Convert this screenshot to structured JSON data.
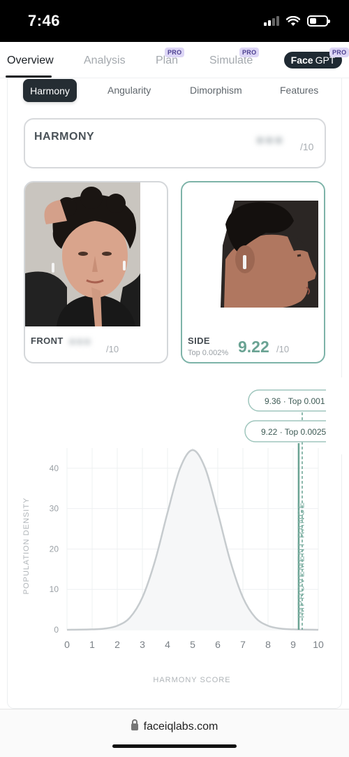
{
  "status_bar": {
    "time": "7:46",
    "icons": [
      "signal-icon",
      "wifi-icon",
      "battery-icon"
    ]
  },
  "nav": {
    "tabs": [
      {
        "label": "Overview",
        "active": true,
        "pro": false
      },
      {
        "label": "Analysis",
        "active": false,
        "pro": false
      },
      {
        "label": "Plan",
        "active": false,
        "pro": true
      },
      {
        "label": "Simulate",
        "active": false,
        "pro": true
      }
    ],
    "facegpt": {
      "bold": "Face",
      "rest": "GPT"
    },
    "pro_label": "PRO"
  },
  "sub_tabs": [
    {
      "label": "Harmony",
      "active": true
    },
    {
      "label": "Angularity",
      "active": false
    },
    {
      "label": "Dimorphism",
      "active": false
    },
    {
      "label": "Features",
      "active": false
    }
  ],
  "harmony": {
    "title": "HARMONY",
    "out_of": "/10"
  },
  "front": {
    "label": "FRONT",
    "out_of": "/10"
  },
  "side": {
    "label": "SIDE",
    "rank": "Top 0.002%",
    "score": "9.22",
    "out_of": "/10"
  },
  "chart_data": {
    "type": "area",
    "xlabel": "HARMONY SCORE",
    "ylabel": "POPULATION DENSITY",
    "x_ticks": [
      0,
      1,
      2,
      3,
      4,
      5,
      6,
      7,
      8,
      9,
      10
    ],
    "y_ticks": [
      0,
      10,
      20,
      30,
      40
    ],
    "xlim": [
      0,
      10
    ],
    "ylim": [
      0,
      45
    ],
    "curve": {
      "x": [
        0,
        1,
        1.5,
        2,
        2.5,
        3,
        3.5,
        4,
        4.5,
        5,
        5.5,
        6,
        6.5,
        7,
        7.5,
        8,
        8.5,
        9,
        10
      ],
      "y": [
        0,
        0.1,
        0.3,
        1,
        3,
        8,
        17,
        29,
        40,
        44.5,
        40,
        29,
        17,
        8,
        3,
        1,
        0.3,
        0.1,
        0
      ]
    },
    "markers": [
      {
        "value": 9.36,
        "label": "9.36 · Top 0.001",
        "style": "dashed"
      },
      {
        "value": 9.22,
        "label": "9.22 · Top 0.0025",
        "style": "solid"
      }
    ],
    "band_label": "IMPROVEMENT RANGE",
    "colors": {
      "curve": "#c6cbce",
      "marker": "#6aa393",
      "grid": "#eef0f2",
      "axis_text": "#7a8086"
    }
  },
  "url_bar": {
    "url": "faceiqlabs.com"
  }
}
